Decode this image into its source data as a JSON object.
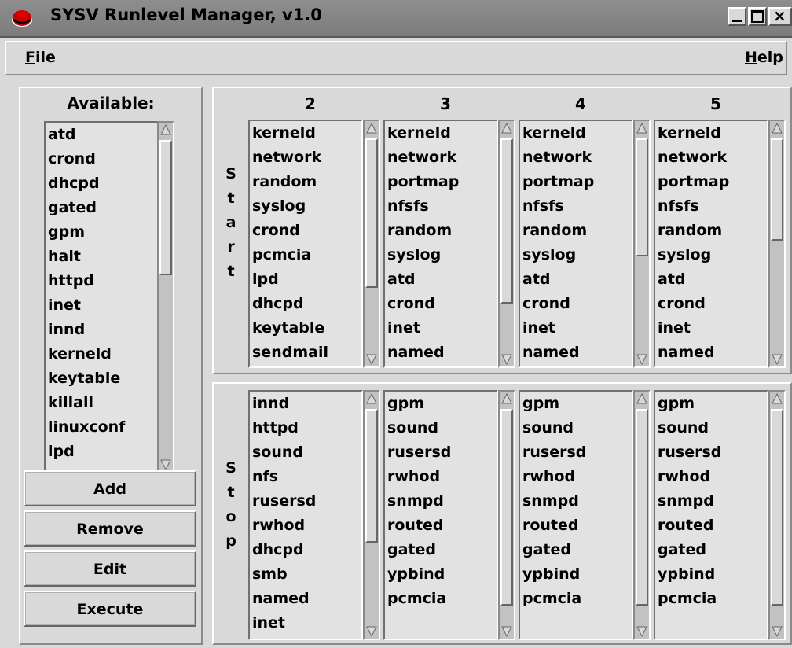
{
  "window": {
    "title": "SYSV Runlevel Manager, v1.0",
    "controls": [
      "minimize",
      "maximize",
      "close"
    ],
    "close_glyph": "×"
  },
  "menubar": {
    "file": "File",
    "help": "Help",
    "file_mnemonic": "F",
    "file_rest": "ile",
    "help_mnemonic": "H",
    "help_rest": "elp"
  },
  "available": {
    "label": "Available:",
    "items": [
      "atd",
      "crond",
      "dhcpd",
      "gated",
      "gpm",
      "halt",
      "httpd",
      "inet",
      "innd",
      "kerneld",
      "keytable",
      "killall",
      "linuxconf",
      "lpd"
    ]
  },
  "buttons": {
    "add": "Add",
    "remove": "Remove",
    "edit": "Edit",
    "execute": "Execute"
  },
  "start_label": [
    "S",
    "t",
    "a",
    "r",
    "t"
  ],
  "stop_label": [
    "S",
    "t",
    "o",
    "p"
  ],
  "runlevels": [
    {
      "level": "2",
      "start": [
        "kerneld",
        "network",
        "random",
        "syslog",
        "crond",
        "pcmcia",
        "lpd",
        "dhcpd",
        "keytable",
        "sendmail"
      ],
      "stop": [
        "innd",
        "httpd",
        "sound",
        "nfs",
        "rusersd",
        "rwhod",
        "dhcpd",
        "smb",
        "named",
        "inet"
      ]
    },
    {
      "level": "3",
      "start": [
        "kerneld",
        "network",
        "portmap",
        "nfsfs",
        "random",
        "syslog",
        "atd",
        "crond",
        "inet",
        "named"
      ],
      "stop": [
        "gpm",
        "sound",
        "rusersd",
        "rwhod",
        "snmpd",
        "routed",
        "gated",
        "ypbind",
        "pcmcia"
      ]
    },
    {
      "level": "4",
      "start": [
        "kerneld",
        "network",
        "portmap",
        "nfsfs",
        "random",
        "syslog",
        "atd",
        "crond",
        "inet",
        "named"
      ],
      "stop": [
        "gpm",
        "sound",
        "rusersd",
        "rwhod",
        "snmpd",
        "routed",
        "gated",
        "ypbind",
        "pcmcia"
      ]
    },
    {
      "level": "5",
      "start": [
        "kerneld",
        "network",
        "portmap",
        "nfsfs",
        "random",
        "syslog",
        "atd",
        "crond",
        "inet",
        "named"
      ],
      "stop": [
        "gpm",
        "sound",
        "rusersd",
        "rwhod",
        "snmpd",
        "routed",
        "gated",
        "ypbind",
        "pcmcia"
      ]
    }
  ],
  "colors": {
    "background": "#d9d9d9",
    "titlebar": "#808080",
    "list_bg": "#e2e2e2",
    "logo": "#cc0000"
  }
}
